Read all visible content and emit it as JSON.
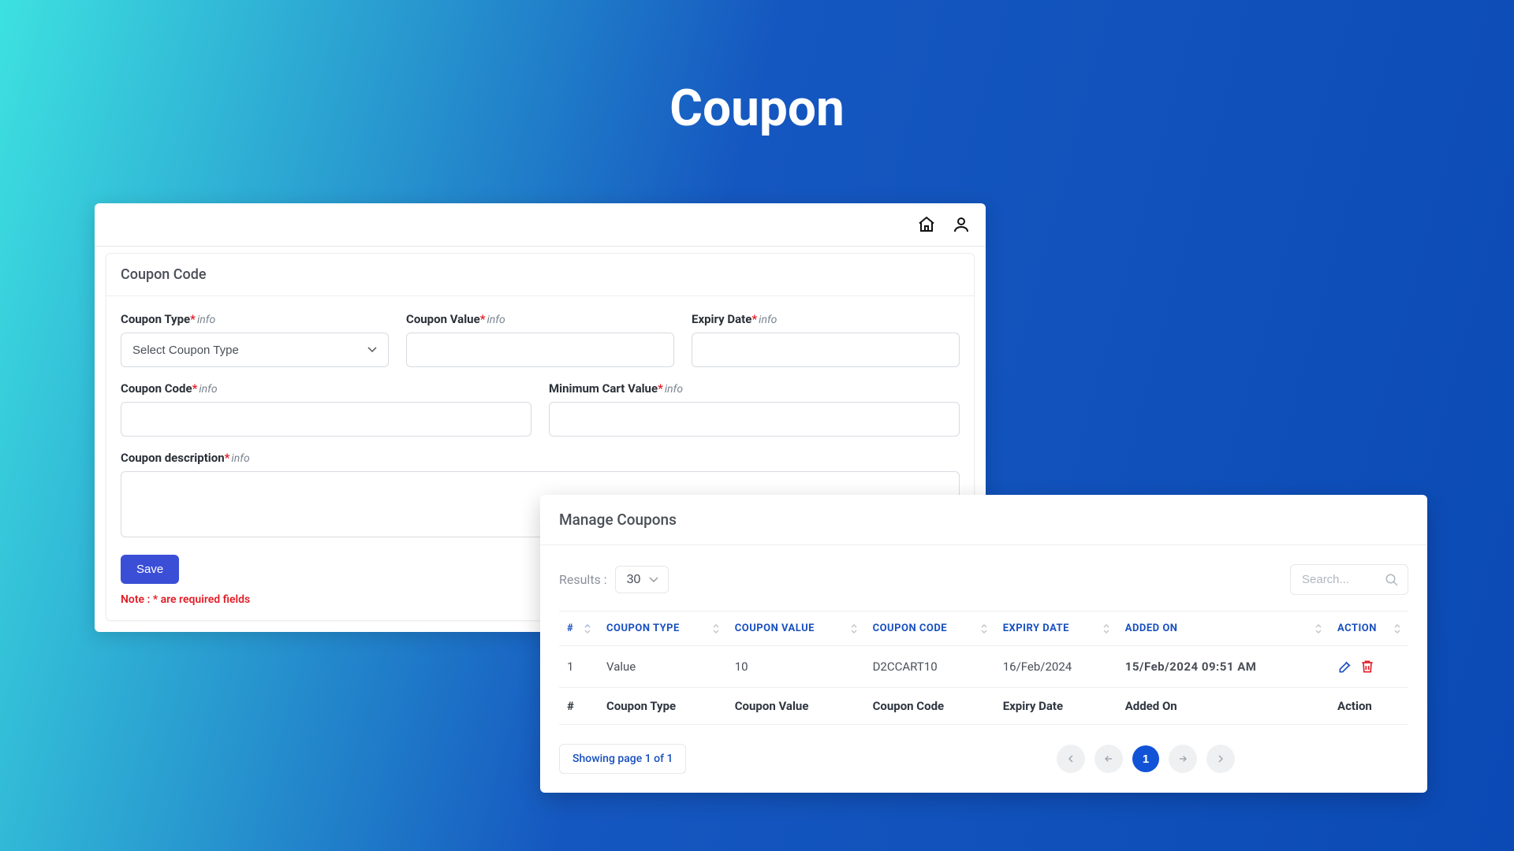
{
  "page_title": "Coupon",
  "panel1": {
    "card_title": "Coupon Code",
    "fields": {
      "coupon_type_label": "Coupon Type",
      "coupon_type_placeholder": "Select Coupon Type",
      "coupon_value_label": "Coupon Value",
      "expiry_date_label": "Expiry Date",
      "coupon_code_label": "Coupon Code",
      "min_cart_label": "Minimum Cart Value",
      "description_label": "Coupon description",
      "info_text": "info"
    },
    "save_label": "Save",
    "note_text": "Note : * are required fields"
  },
  "panel2": {
    "title": "Manage Coupons",
    "results_label": "Results :",
    "results_value": "30",
    "search_placeholder": "Search...",
    "columns": {
      "idx": "#",
      "type": "COUPON TYPE",
      "value": "COUPON VALUE",
      "code": "COUPON CODE",
      "expiry": "EXPIRY DATE",
      "added": "ADDED ON",
      "action": "ACTION"
    },
    "rows": [
      {
        "idx": "1",
        "type": "Value",
        "value": "10",
        "code": "D2CCART10",
        "expiry": "16/Feb/2024",
        "added": "15/Feb/2024 09:51 AM"
      }
    ],
    "footer_cols": {
      "idx": "#",
      "type": "Coupon Type",
      "value": "Coupon Value",
      "code": "Coupon Code",
      "expiry": "Expiry Date",
      "added": "Added On",
      "action": "Action"
    },
    "page_indicator": "Showing page 1 of 1",
    "current_page": "1"
  }
}
